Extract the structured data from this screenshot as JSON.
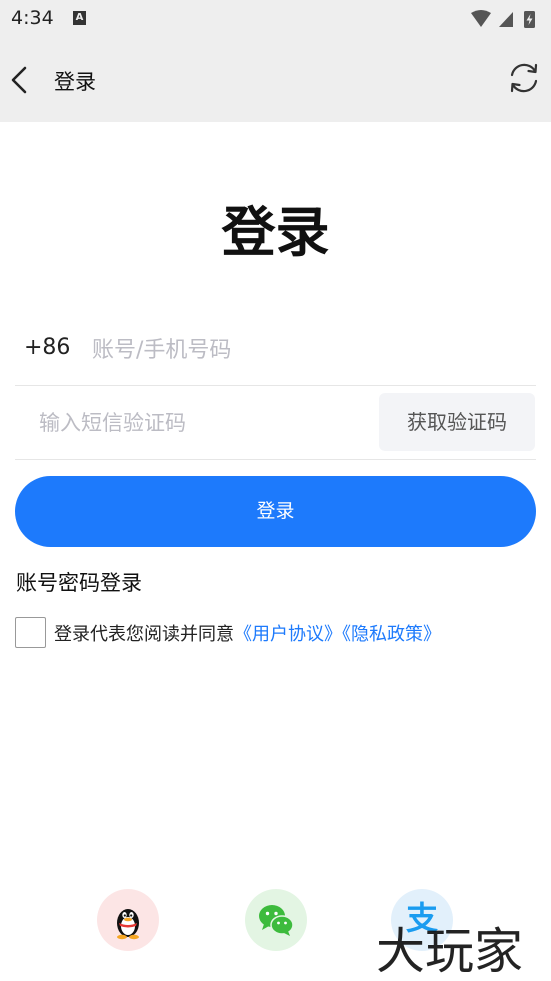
{
  "status_bar": {
    "time": "4:34",
    "badge": "A",
    "icons": [
      "wifi-icon",
      "signal-icon",
      "battery-charging-icon"
    ]
  },
  "app_bar": {
    "title": "登录",
    "back_icon": "back-chevron-icon",
    "refresh_icon": "refresh-icon"
  },
  "page": {
    "title": "登录"
  },
  "form": {
    "country_code": "+86",
    "phone_placeholder": "账号/手机号码",
    "phone_value": "",
    "code_placeholder": "输入短信验证码",
    "code_value": "",
    "get_code_label": "获取验证码",
    "login_label": "登录"
  },
  "password_login_label": "账号密码登录",
  "agreement": {
    "checked": false,
    "prefix": "登录代表您阅读并同意",
    "user_agreement": "《用户协议》",
    "privacy_policy": "《隐私政策》"
  },
  "social_login": {
    "items": [
      {
        "name": "qq",
        "icon": "qq-penguin-icon"
      },
      {
        "name": "wechat",
        "icon": "wechat-icon"
      },
      {
        "name": "alipay",
        "icon": "alipay-icon",
        "glyph": "支"
      }
    ]
  },
  "watermark": "大玩家",
  "colors": {
    "accent": "#1d7afc",
    "bar_bg": "#eeeeee",
    "get_code_bg": "#f3f4f7",
    "qq_bg": "#fce5e5",
    "wechat_bg": "#e3f5e3",
    "alipay_bg": "#e2f0fb"
  }
}
